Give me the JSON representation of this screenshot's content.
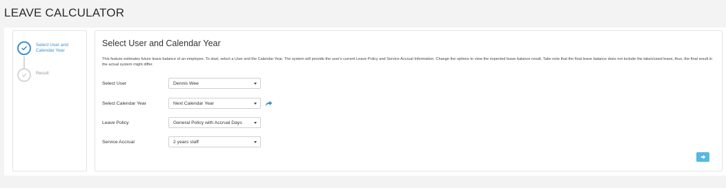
{
  "page": {
    "title": "LEAVE CALCULATOR"
  },
  "wizard": {
    "steps": [
      {
        "label": "Select User and Calendar Year",
        "state": "active"
      },
      {
        "label": "Result",
        "state": "pending"
      }
    ],
    "active_color": "#3a8fd2",
    "inactive_color": "#d6d6d6"
  },
  "panel": {
    "title": "Select User and Calendar Year",
    "description": "This feature estimates future leave balance of an employee. To start, select a User and the Calendar Year. The system will provide the user's current Leave Policy and Service Accrual Information. Change the options to view the expected leave balance result. Take note that the final leave balance does not include the taken/used leave, thus, the final result in the actual system might differ.",
    "fields": {
      "user": {
        "label": "Select User",
        "value": "Dennis Wee"
      },
      "calendar_year": {
        "label": "Select Calendar Year",
        "value": "Next Calendar Year"
      },
      "leave_policy": {
        "label": "Leave Policy",
        "value": "General Policy with Accrual Days"
      },
      "service_accrual": {
        "label": "Service Accrual",
        "value": "2 years staff"
      }
    },
    "next_button": {
      "icon": "arrow-right-icon",
      "color": "#57b8e3"
    },
    "share_icon": {
      "icon": "share-arrow-icon",
      "color": "#3a8fd2"
    }
  }
}
